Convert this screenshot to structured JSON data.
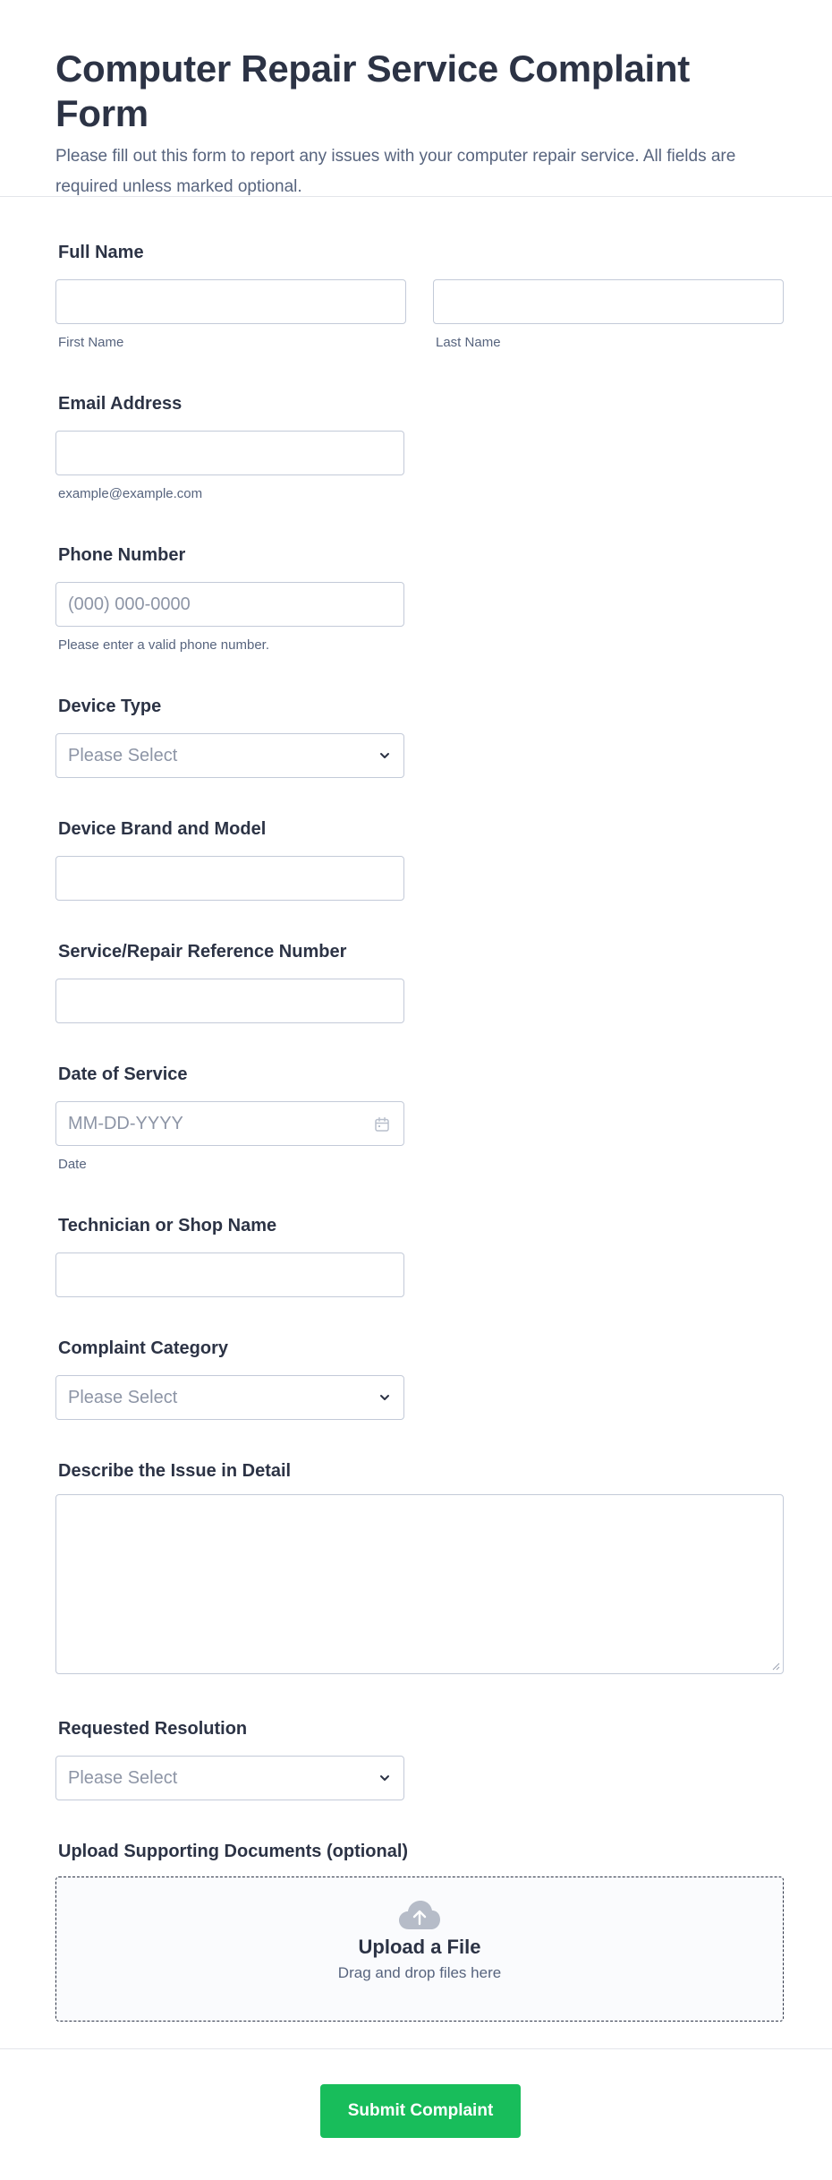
{
  "header": {
    "title": "Computer Repair Service Complaint Form",
    "description": "Please fill out this form to report any issues with your computer repair service. All fields are required unless marked optional."
  },
  "fields": {
    "full_name": {
      "label": "Full Name",
      "first_sublabel": "First Name",
      "last_sublabel": "Last Name"
    },
    "email": {
      "label": "Email Address",
      "sublabel": "example@example.com"
    },
    "phone": {
      "label": "Phone Number",
      "placeholder": "(000) 000-0000",
      "sublabel": "Please enter a valid phone number."
    },
    "device_type": {
      "label": "Device Type",
      "selected": "Please Select"
    },
    "device_brand": {
      "label": "Device Brand and Model"
    },
    "reference": {
      "label": "Service/Repair Reference Number"
    },
    "date": {
      "label": "Date of Service",
      "placeholder": "MM-DD-YYYY",
      "sublabel": "Date"
    },
    "technician": {
      "label": "Technician or Shop Name"
    },
    "category": {
      "label": "Complaint Category",
      "selected": "Please Select"
    },
    "describe": {
      "label": "Describe the Issue in Detail"
    },
    "resolution": {
      "label": "Requested Resolution",
      "selected": "Please Select"
    },
    "upload": {
      "label": "Upload Supporting Documents (optional)",
      "title": "Upload a File",
      "hint": "Drag and drop files here"
    }
  },
  "submit_label": "Submit Complaint",
  "colors": {
    "accent": "#18bd5b",
    "text": "#2c3345",
    "muted": "#57647e",
    "border": "#c3cad8"
  },
  "icons": {
    "select": "chevron-down-icon",
    "date": "calendar-icon",
    "upload": "cloud-upload-icon"
  }
}
